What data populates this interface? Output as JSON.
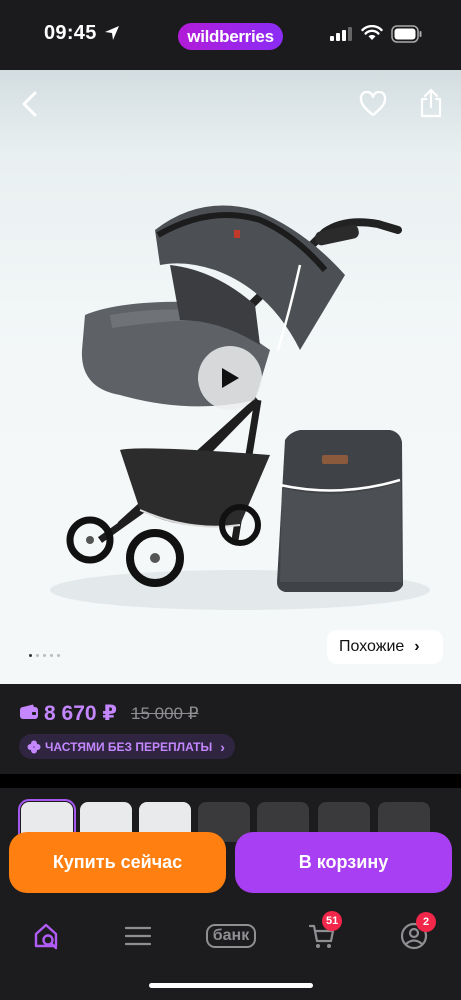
{
  "status_bar": {
    "time": "09:45",
    "app_pill": "wildberries"
  },
  "product_image": {
    "alt": "stroller-with-bag",
    "similar_label": "Похожие",
    "slide_count": 5,
    "active_slide": 1
  },
  "price": {
    "current": "8 670 ₽",
    "old": "15 000 ₽",
    "installments_label": "ЧАСТЯМИ БЕЗ ПЕРЕПЛАТЫ"
  },
  "thumbnails": {
    "count": 7,
    "selected_index": 0
  },
  "actions": {
    "buy_now": "Купить сейчас",
    "add_to_cart": "В корзину"
  },
  "tab_bar": {
    "bank_label": "банк",
    "cart_badge": "51",
    "profile_badge": "2"
  },
  "colors": {
    "accent_purple": "#a83ff2",
    "price_purple": "#c487ff",
    "buy_orange": "#ff7f10",
    "badge_red": "#f2274a"
  }
}
